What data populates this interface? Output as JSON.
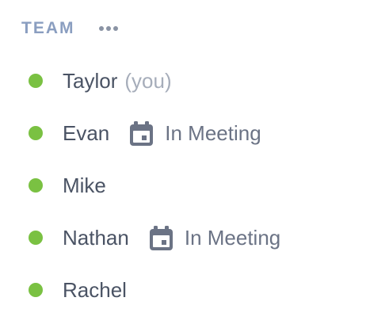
{
  "team": {
    "title": "TEAM",
    "more_icon": "more-horizontal-icon",
    "presence_color": "#7ac142",
    "members": [
      {
        "name": "Taylor",
        "suffix": "(you)",
        "status": ""
      },
      {
        "name": "Evan",
        "suffix": "",
        "status": "In Meeting",
        "status_icon": "calendar-icon"
      },
      {
        "name": "Mike",
        "suffix": "",
        "status": ""
      },
      {
        "name": "Nathan",
        "suffix": "",
        "status": "In Meeting",
        "status_icon": "calendar-icon"
      },
      {
        "name": "Rachel",
        "suffix": "",
        "status": ""
      }
    ]
  }
}
